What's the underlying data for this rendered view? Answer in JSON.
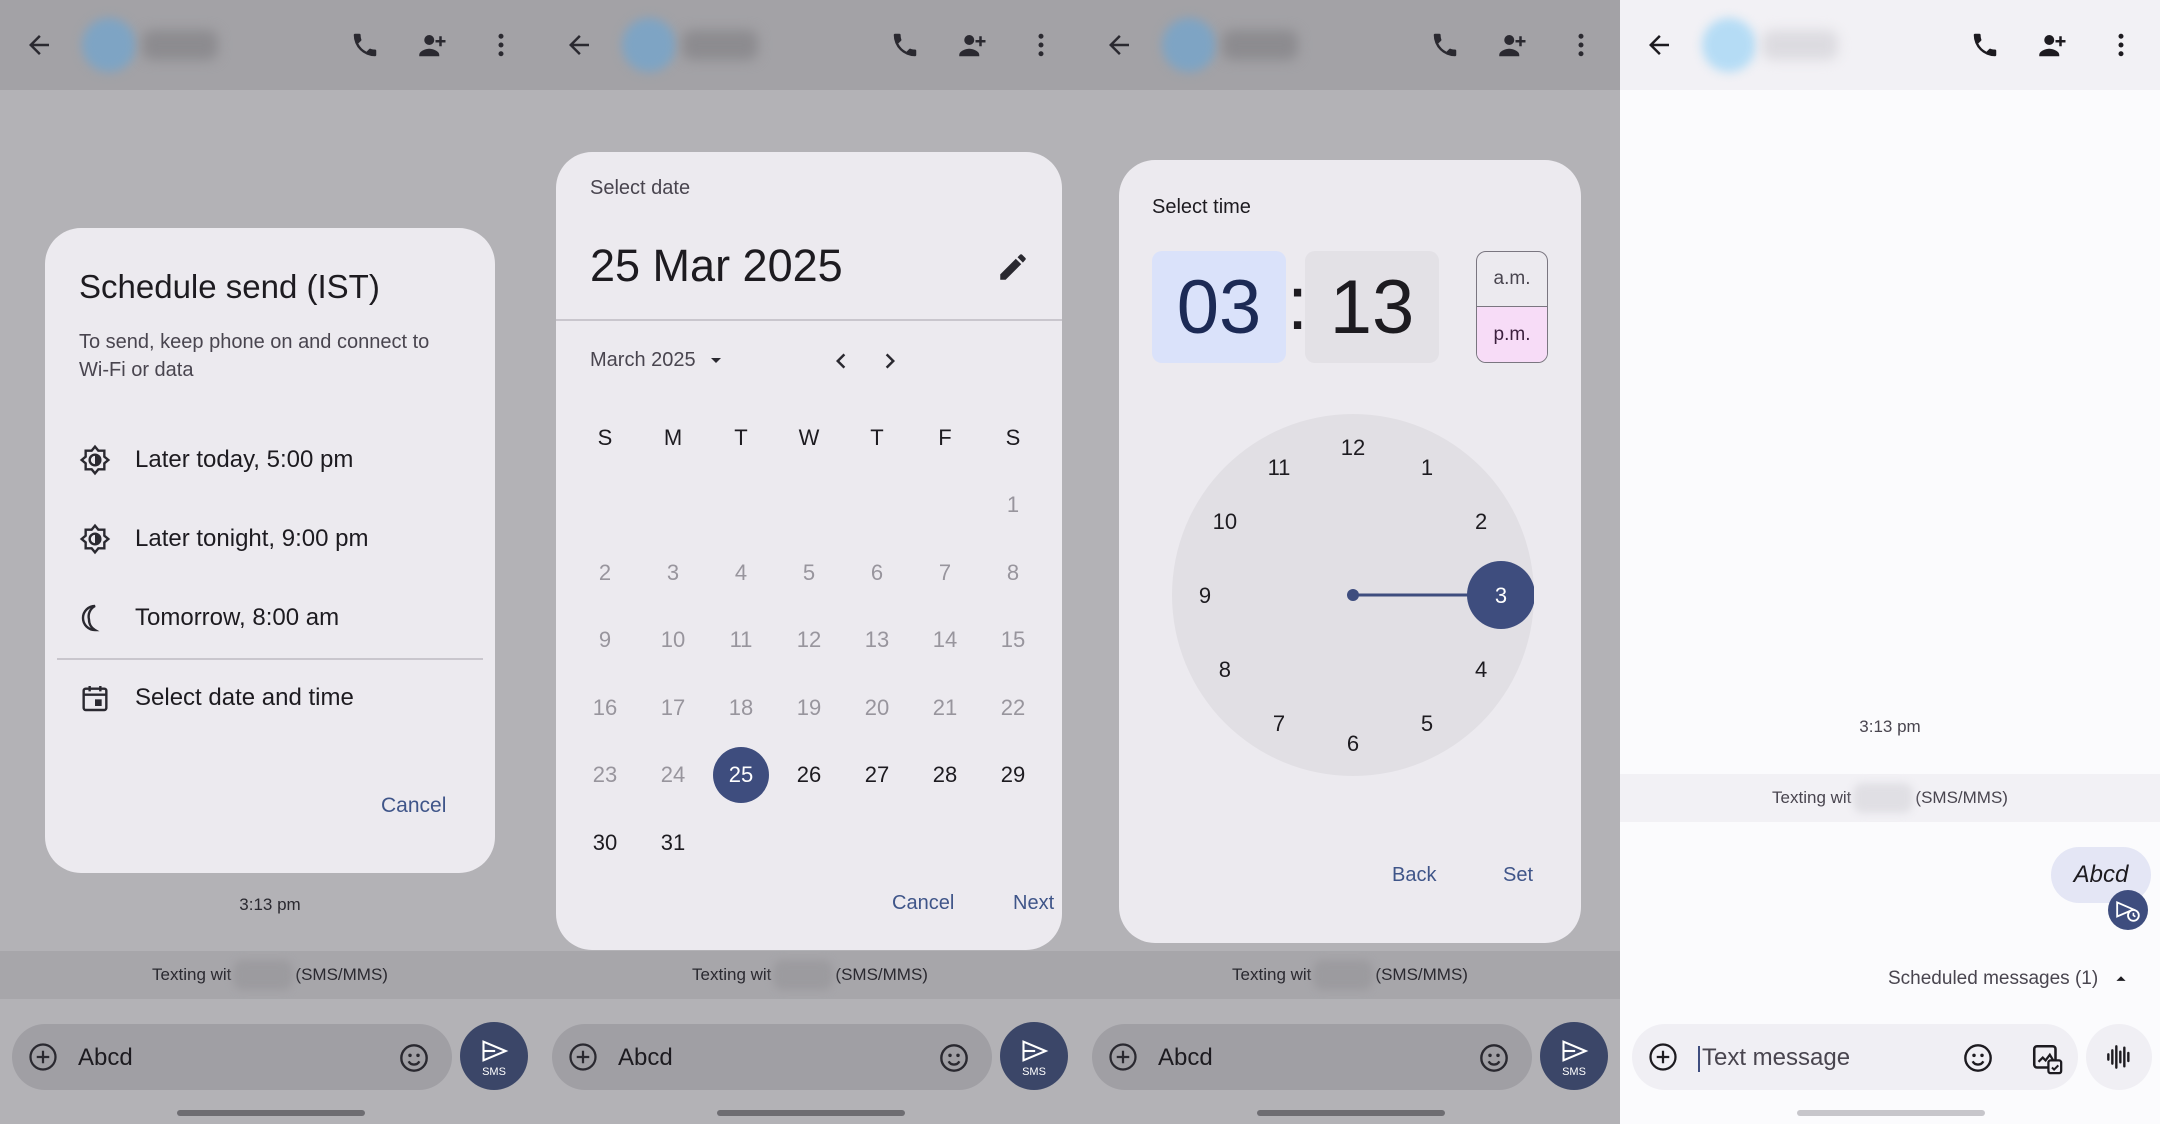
{
  "panels": {
    "common": {
      "timestamp": "3:13 pm",
      "texting_prefix": "Texting wit",
      "texting_suffix": "(SMS/MMS)",
      "compose_text": "Abcd",
      "send_label": "SMS"
    },
    "schedule": {
      "title": "Schedule send (IST)",
      "subtitle": "To send, keep phone on and connect to Wi-Fi or data",
      "options": [
        {
          "label": "Later today, 5:00 pm",
          "icon": "sun-icon"
        },
        {
          "label": "Later tonight, 9:00 pm",
          "icon": "sun-icon"
        },
        {
          "label": "Tomorrow, 8:00 am",
          "icon": "moon-icon"
        },
        {
          "label": "Select date and time",
          "icon": "calendar-icon"
        }
      ],
      "cancel": "Cancel"
    },
    "date": {
      "label": "Select date",
      "selected": "25 Mar 2025",
      "month": "March 2025",
      "weekdays": [
        "S",
        "M",
        "T",
        "W",
        "T",
        "F",
        "S"
      ],
      "weeks": [
        [
          "",
          "",
          "",
          "",
          "",
          "",
          "1"
        ],
        [
          "2",
          "3",
          "4",
          "5",
          "6",
          "7",
          "8"
        ],
        [
          "9",
          "10",
          "11",
          "12",
          "13",
          "14",
          "15"
        ],
        [
          "16",
          "17",
          "18",
          "19",
          "20",
          "21",
          "22"
        ],
        [
          "23",
          "24",
          "25",
          "26",
          "27",
          "28",
          "29"
        ],
        [
          "30",
          "31",
          "",
          "",
          "",
          "",
          ""
        ]
      ],
      "selected_day": "25",
      "cancel": "Cancel",
      "next": "Next"
    },
    "time": {
      "label": "Select time",
      "hour": "03",
      "colon": ":",
      "minute": "13",
      "am": "a.m.",
      "pm": "p.m.",
      "selected_period": "p.m.",
      "dial_numbers": [
        "12",
        "1",
        "2",
        "3",
        "4",
        "5",
        "6",
        "7",
        "8",
        "9",
        "10",
        "11"
      ],
      "selected_hour": "3",
      "back": "Back",
      "set": "Set"
    },
    "conversation": {
      "timestamp": "3:13 pm",
      "texting_prefix": "Texting wit",
      "texting_suffix": "(SMS/MMS)",
      "message": "Abcd",
      "scheduled": "Scheduled messages (1)",
      "placeholder": "Text message"
    }
  },
  "colors": {
    "accent": "#3e4d7e",
    "link": "#3f5589",
    "scrim": "#b3b2b6",
    "dialog": "#eceaef"
  }
}
